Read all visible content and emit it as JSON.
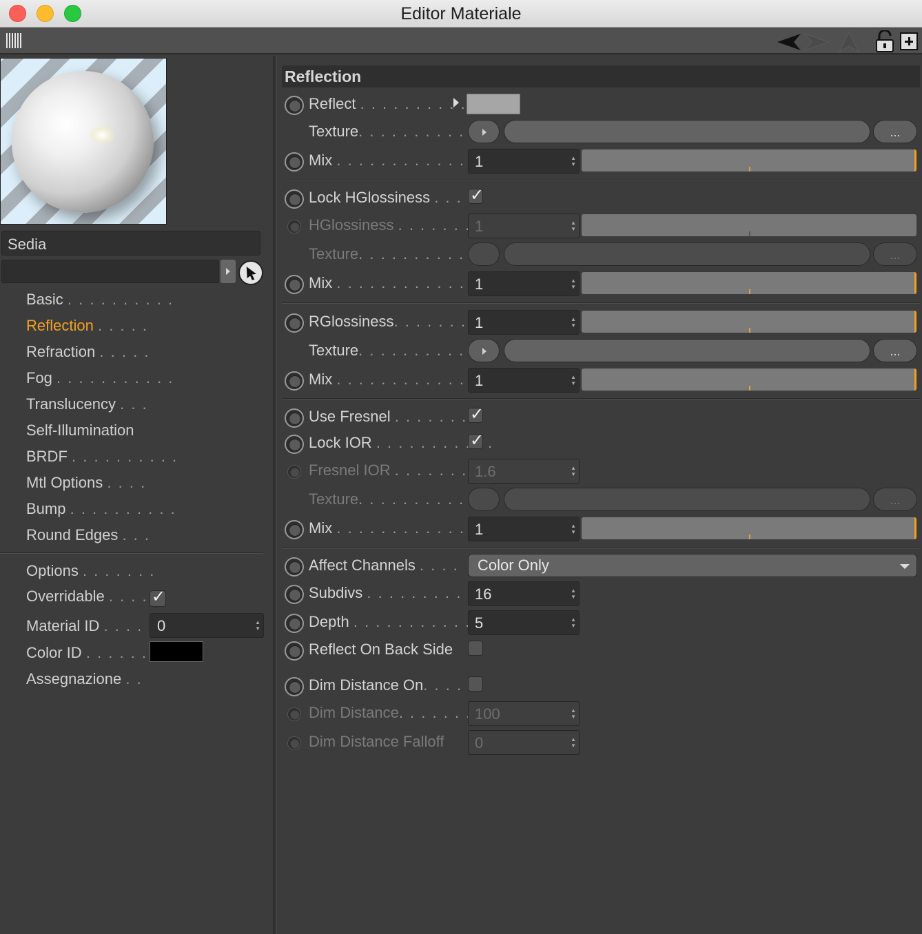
{
  "window": {
    "title": "Editor Materiale"
  },
  "material": {
    "name": "Sedia",
    "path": ""
  },
  "nav": {
    "items": [
      {
        "label": "Basic",
        "dots": ". . . . . . . . . ."
      },
      {
        "label": "Reflection",
        "dots": ". . . . .",
        "active": true
      },
      {
        "label": "Refraction",
        "dots": ". . . . ."
      },
      {
        "label": "Fog",
        "dots": ". . . . . . . . . . ."
      },
      {
        "label": "Translucency",
        "dots": ". . ."
      },
      {
        "label": "Self-Illumination",
        "dots": ""
      },
      {
        "label": "BRDF",
        "dots": ". . . . . . . . . ."
      },
      {
        "label": "Mtl Options",
        "dots": ". . . ."
      },
      {
        "label": "Bump",
        "dots": ". . . . . . . . . ."
      },
      {
        "label": "Round Edges",
        "dots": ". . ."
      }
    ]
  },
  "options": {
    "options_label": "Options",
    "options_dots": ". . . . . . .",
    "overridable_label": "Overridable",
    "overridable_dots": ". . . .",
    "overridable_checked": true,
    "material_id_label": "Material ID",
    "material_id_dots": ". . . . .",
    "material_id_value": "0",
    "color_id_label": "Color ID",
    "color_id_dots": ". . . . . . .",
    "color_id_color": "#000000",
    "assign_label": "Assegnazione",
    "assign_dots": ". ."
  },
  "section": {
    "title": "Reflection"
  },
  "params": {
    "reflect_label": "Reflect",
    "reflect_dots": ". . . . . . . . . .",
    "reflect_color": "#a6a6a6",
    "texture_label": "Texture",
    "texture_dots": ". . . . . . . . . . . .",
    "ellipsis": "...",
    "mix_label": "Mix",
    "mix_dots": ". . . . . . . . . . . . . . .",
    "mix_value": "1",
    "lock_hgloss_label": "Lock HGlossiness",
    "lock_hgloss_dots": ". . .",
    "lock_hgloss_checked": true,
    "hgloss_label": "HGlossiness",
    "hgloss_dots": ". . . . . . .",
    "hgloss_value": "1",
    "rgloss_label": "RGlossiness",
    "rgloss_dots": ". . . . . . . .",
    "rgloss_value": "1",
    "fresnel_label": "Use Fresnel",
    "fresnel_dots": ". . . . . . . .",
    "fresnel_checked": true,
    "lock_ior_label": "Lock IOR",
    "lock_ior_dots": ". . . . . . . . . . .",
    "lock_ior_checked": true,
    "fresnel_ior_label": "Fresnel IOR",
    "fresnel_ior_dots": ". . . . . . . .",
    "fresnel_ior_value": "1.6",
    "affect_label": "Affect Channels",
    "affect_dots": ". . . .",
    "affect_value": "Color Only",
    "subdivs_label": "Subdivs",
    "subdivs_dots": ". . . . . . . . . . .",
    "subdivs_value": "16",
    "depth_label": "Depth",
    "depth_dots": ". . . . . . . . . . . . . .",
    "depth_value": "5",
    "backside_label": "Reflect On Back Side",
    "backside_checked": false,
    "dimon_label": "Dim Distance On",
    "dimon_dots": ". . . .",
    "dimon_checked": false,
    "dimdist_label": "Dim Distance",
    "dimdist_dots": ". . . . . . .",
    "dimdist_value": "100",
    "dimfall_label": "Dim Distance Falloff",
    "dimfall_value": "0"
  },
  "sliders": {
    "mix_fill": 1.0,
    "hgloss_fill": 1.0,
    "rgloss_fill": 1.0
  },
  "icons": [
    "grid-icon",
    "back-arrow-icon",
    "forward-arrow-icon",
    "up-arrow-icon",
    "unlock-icon",
    "new-window-icon",
    "pick-cursor-icon"
  ],
  "colors": {
    "accent": "#f5a020"
  }
}
